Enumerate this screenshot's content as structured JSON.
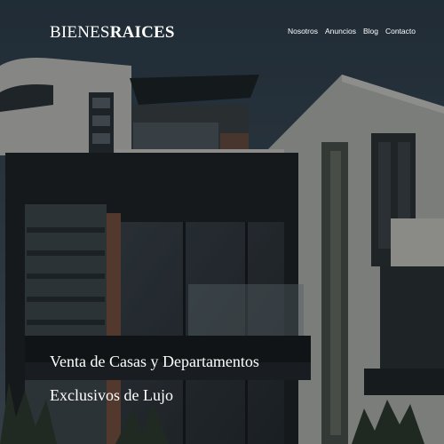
{
  "brand": {
    "light": "BIENES",
    "bold": "RAICES"
  },
  "nav": {
    "items": [
      {
        "label": "Nosotros"
      },
      {
        "label": "Anuncios"
      },
      {
        "label": "Blog"
      },
      {
        "label": "Contacto"
      }
    ]
  },
  "hero": {
    "line1": "Venta de Casas y Departamentos",
    "line2": "Exclusivos de Lujo"
  }
}
